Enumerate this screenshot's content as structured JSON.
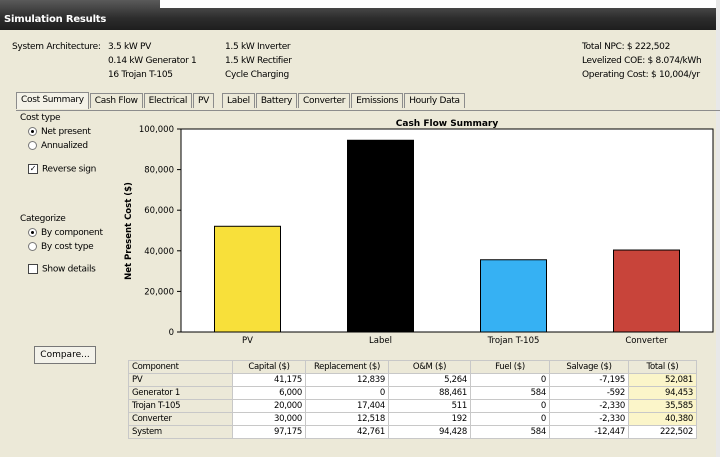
{
  "window": {
    "title": "Simulation Results"
  },
  "architecture": {
    "label": "System Architecture:",
    "col1": [
      "3.5 kW PV",
      "0.14 kW Generator 1",
      "16 Trojan T-105"
    ],
    "col2": [
      "1.5 kW Inverter",
      "1.5 kW Rectifier",
      "Cycle Charging"
    ],
    "col3": [
      "Total NPC: $ 222,502",
      "Levelized COE: $ 8.074/kWh",
      "Operating Cost: $ 10,004/yr"
    ]
  },
  "tabs": [
    "Cost Summary",
    "Cash Flow",
    "Electrical",
    "PV",
    "Label",
    "Battery",
    "Converter",
    "Emissions",
    "Hourly Data"
  ],
  "cost_type": {
    "label": "Cost type",
    "options": [
      "Net present",
      "Annualized"
    ],
    "selected": 0,
    "reverse_sign": "Reverse sign",
    "reverse_checked": true
  },
  "categorize": {
    "label": "Categorize",
    "options": [
      "By component",
      "By cost type"
    ],
    "selected": 0,
    "show_details": "Show details",
    "show_checked": false
  },
  "compare_button": "Compare...",
  "colors": {
    "pv": "#f8e03a",
    "label": "#000000",
    "trojan": "#36b1f3",
    "converter": "#c8443a"
  },
  "chart_data": {
    "type": "bar",
    "title": "Cash Flow Summary",
    "ylabel": "Net Present Cost ($)",
    "categories": [
      "PV",
      "Label",
      "Trojan T-105",
      "Converter"
    ],
    "values": [
      52081,
      94453,
      35585,
      40380
    ],
    "ylim": [
      0,
      100000
    ],
    "yticks": [
      "0",
      "20,000",
      "40,000",
      "60,000",
      "80,000",
      "100,000"
    ],
    "grid": false
  },
  "table": {
    "headers": [
      "Component",
      "Capital ($)",
      "Replacement ($)",
      "O&M ($)",
      "Fuel ($)",
      "Salvage ($)",
      "Total ($)"
    ],
    "rows": [
      [
        "PV",
        "41,175",
        "12,839",
        "5,264",
        "0",
        "-7,195",
        "52,081"
      ],
      [
        "Generator 1",
        "6,000",
        "0",
        "88,461",
        "584",
        "-592",
        "94,453"
      ],
      [
        "Trojan T-105",
        "20,000",
        "17,404",
        "511",
        "0",
        "-2,330",
        "35,585"
      ],
      [
        "Converter",
        "30,000",
        "12,518",
        "192",
        "0",
        "-2,330",
        "40,380"
      ],
      [
        "System",
        "97,175",
        "42,761",
        "94,428",
        "584",
        "-12,447",
        "222,502"
      ]
    ]
  }
}
